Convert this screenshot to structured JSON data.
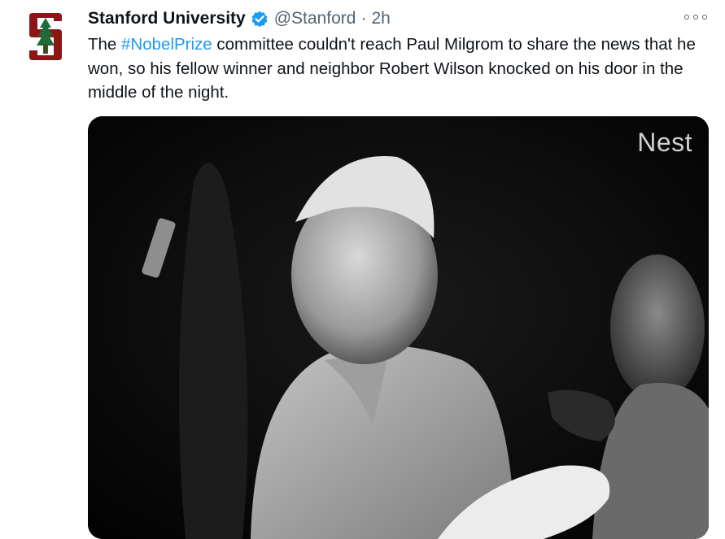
{
  "tweet": {
    "display_name": "Stanford University",
    "handle": "@Stanford",
    "separator": "·",
    "time": "2h",
    "text_before": "The ",
    "hashtag": "#NobelPrize",
    "text_after": " committee couldn't reach Paul Milgrom to share the news that he won, so his fellow winner and neighbor Robert Wilson knocked on his door in the middle of the night.",
    "media": {
      "watermark": "Nest"
    }
  },
  "icons": {
    "avatar": "stanford-tree-logo",
    "verified": "verified-badge-icon",
    "more": "more-options-icon"
  },
  "colors": {
    "link": "#1d9bf0",
    "secondary_text": "#536471",
    "stanford_red": "#8c1515"
  }
}
